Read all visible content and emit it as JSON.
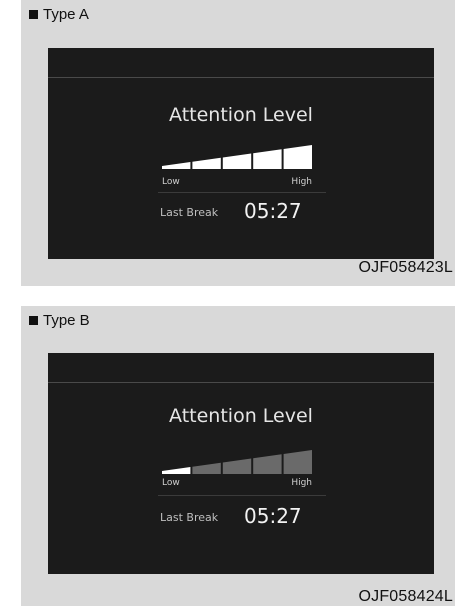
{
  "panels": [
    {
      "type_label": "Type A",
      "code": "OJF058423L",
      "screen": {
        "title": "Attention Level",
        "low_label": "Low",
        "high_label": "High",
        "last_break_label": "Last Break",
        "last_break_time": "05:27",
        "level_segments_filled": 5,
        "level_segments_total": 5
      }
    },
    {
      "type_label": "Type B",
      "code": "OJF058424L",
      "screen": {
        "title": "Attention Level",
        "low_label": "Low",
        "high_label": "High",
        "last_break_label": "Last Break",
        "last_break_time": "05:27",
        "level_segments_filled": 1,
        "level_segments_total": 5
      }
    }
  ],
  "colors": {
    "panel_bg": "#d9d9d9",
    "screen_bg": "#1b1b1b",
    "bar_active": "#ffffff",
    "bar_inactive": "#6a6a6a"
  }
}
